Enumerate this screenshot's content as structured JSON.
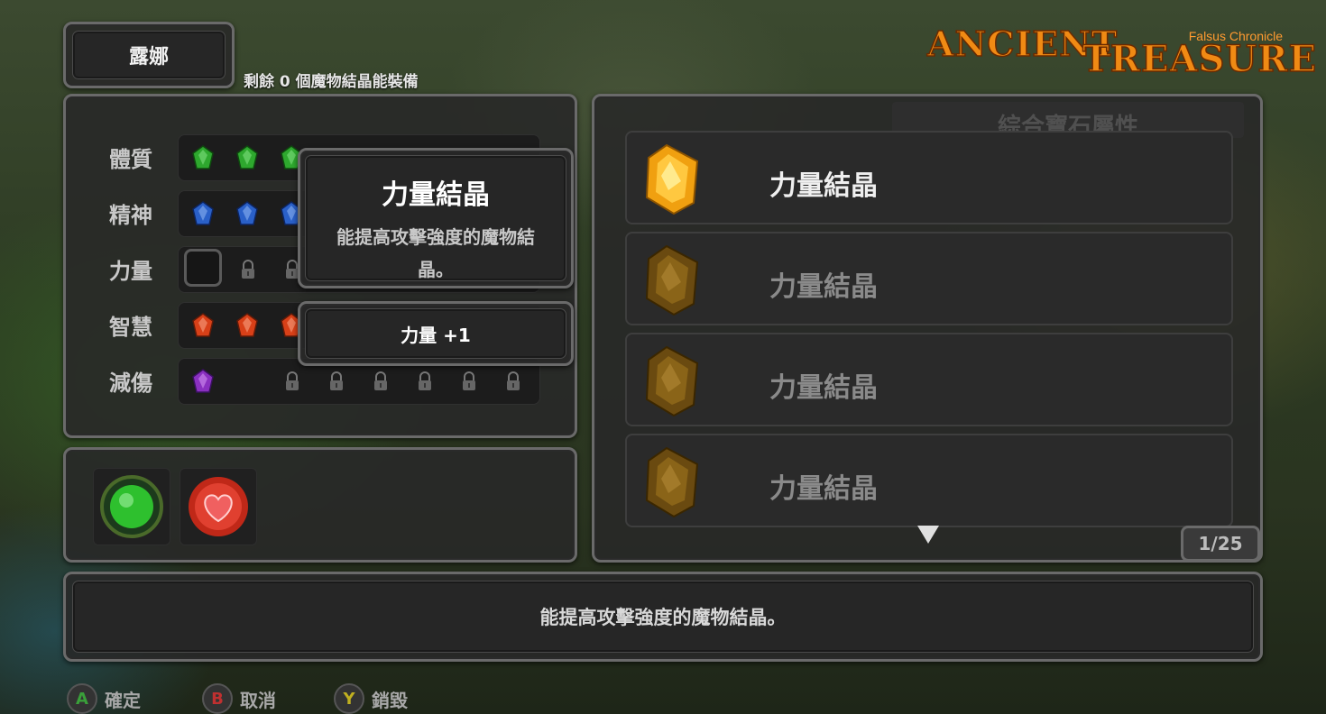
{
  "character": {
    "name": "露娜"
  },
  "remaining_text": "剩餘 0 個魔物結晶能裝備",
  "logo": {
    "part1": "ANCIENT",
    "part2": "TREASURE",
    "subtitle": "Falsus Chronicle"
  },
  "stats": [
    {
      "label": "體質",
      "gem_color": "#2ea82e"
    },
    {
      "label": "精神",
      "gem_color": "#2a60c8"
    },
    {
      "label": "力量",
      "gem_color": "#e8a010"
    },
    {
      "label": "智慧",
      "gem_color": "#d84018"
    },
    {
      "label": "減傷",
      "gem_color": "#8a30c0"
    }
  ],
  "tooltip": {
    "title": "力量結晶",
    "description": "能提高攻擊強度的魔物結晶。",
    "effect": "力量 +1"
  },
  "list": {
    "header": "綜合寶石屬性",
    "items": [
      {
        "name": "力量結晶",
        "selected": true
      },
      {
        "name": "力量結晶",
        "selected": false
      },
      {
        "name": "力量結晶",
        "selected": false
      },
      {
        "name": "力量結晶",
        "selected": false
      }
    ],
    "page": "1/25"
  },
  "description": "能提高攻擊強度的魔物結晶。",
  "hints": [
    {
      "button": "A",
      "label": "確定",
      "color": "#3aa03a"
    },
    {
      "button": "B",
      "label": "取消",
      "color": "#c03030"
    },
    {
      "button": "Y",
      "label": "銷毀",
      "color": "#c0b020"
    }
  ],
  "icons": {
    "orb_green": "green-orb-icon",
    "orb_red": "heart-orb-icon"
  }
}
